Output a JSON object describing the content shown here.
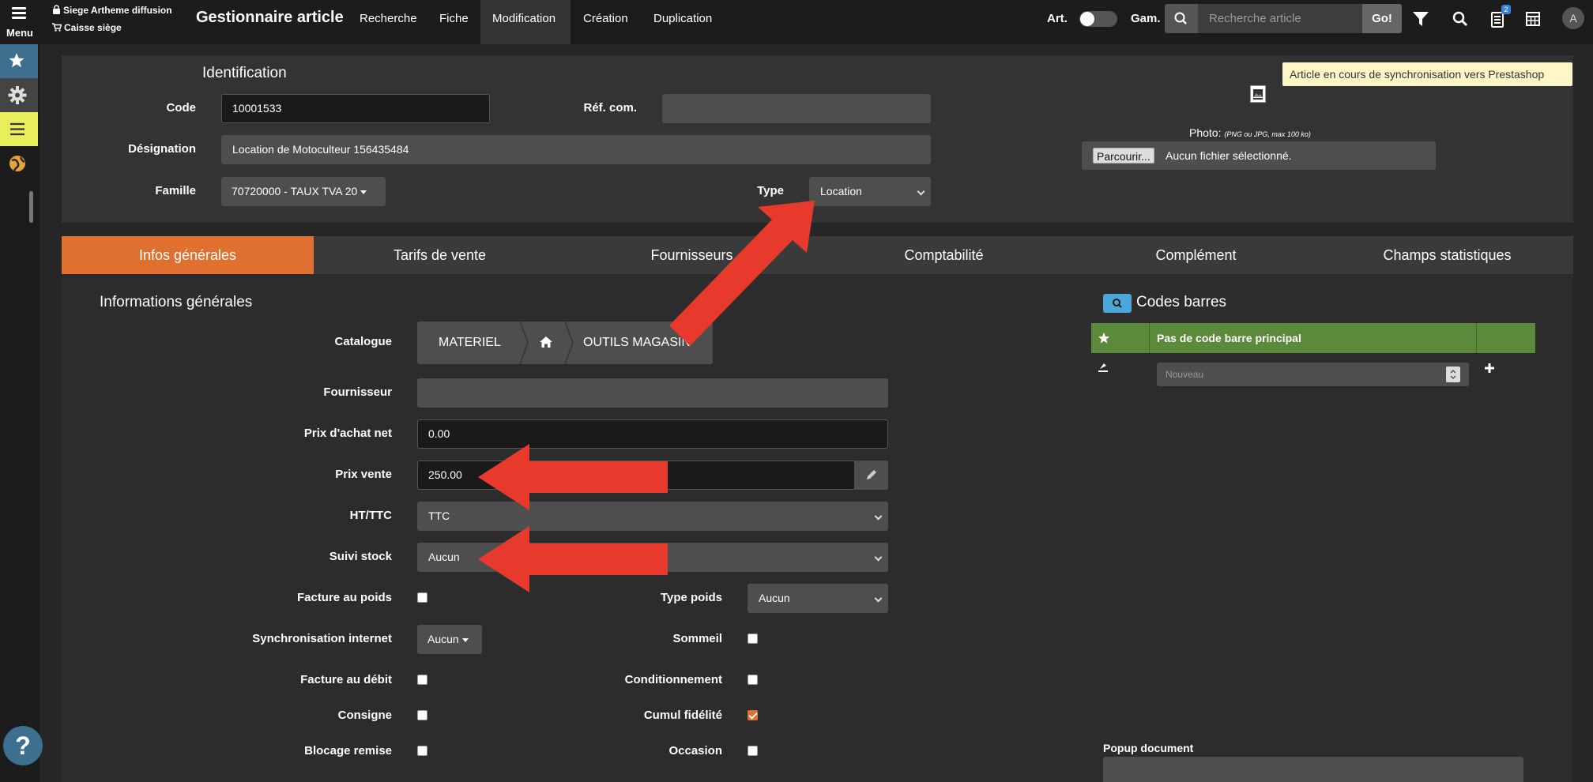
{
  "topbar": {
    "menu_label": "Menu",
    "site_name": "Siege Artheme diffusion",
    "register_name": "Caisse siège",
    "app_title": "Gestionnaire article",
    "nav": [
      "Recherche",
      "Fiche",
      "Modification",
      "Création",
      "Duplication"
    ],
    "active_nav": "Modification",
    "art_label": "Art.",
    "gam_label": "Gam.",
    "search_placeholder": "Recherche article",
    "go_label": "Go!",
    "notification_count": "2",
    "avatar_letter": "A"
  },
  "sidebar": {
    "items": [
      "star-icon",
      "gear-icon",
      "list-icon",
      "globe-icon"
    ],
    "colors": {
      "star_bg": "#3d6f8e",
      "list_bg": "#e8ef5a",
      "active_tab": "#e0702f",
      "barcode_header": "#5a8a3a"
    }
  },
  "identification": {
    "title": "Identification",
    "code_label": "Code",
    "code_value": "10001533",
    "ref_label": "Réf. com.",
    "ref_value": "",
    "designation_label": "Désignation",
    "designation_value": "Location de Motoculteur 156435484",
    "famille_label": "Famille",
    "famille_value": "70720000 - TAUX TVA 20",
    "type_label": "Type",
    "type_value": "Location",
    "photo_label": "Photo:",
    "photo_hint": "(PNG ou JPG, max 100 ko)",
    "browse_label": "Parcourir...",
    "no_file_label": "Aucun fichier sélectionné.",
    "sync_message": "Article en cours de synchronisation vers Prestashop"
  },
  "tabs": [
    "Infos générales",
    "Tarifs de vente",
    "Fournisseurs",
    "Comptabilité",
    "Complément",
    "Champs statistiques"
  ],
  "general": {
    "title": "Informations générales",
    "catalogue_label": "Catalogue",
    "catalogue_path": [
      "MATERIEL",
      "OUTILS MAGASIN"
    ],
    "fournisseur_label": "Fournisseur",
    "fournisseur_value": "",
    "prix_achat_label": "Prix d'achat net",
    "prix_achat_value": "0.00",
    "prix_vente_label": "Prix vente",
    "prix_vente_value": "250.00",
    "ht_ttc_label": "HT/TTC",
    "ht_ttc_value": "TTC",
    "suivi_stock_label": "Suivi stock",
    "suivi_stock_value": "Aucun",
    "facture_poids_label": "Facture au poids",
    "type_poids_label": "Type poids",
    "type_poids_value": "Aucun",
    "sync_internet_label": "Synchronisation internet",
    "sync_internet_value": "Aucun",
    "sommeil_label": "Sommeil",
    "facture_debit_label": "Facture au débit",
    "conditionnement_label": "Conditionnement",
    "consigne_label": "Consigne",
    "cumul_fidelite_label": "Cumul fidélité",
    "cumul_fidelite_checked": true,
    "blocage_remise_label": "Blocage remise",
    "occasion_label": "Occasion"
  },
  "barcodes": {
    "title": "Codes barres",
    "header_text": "Pas de code barre principal",
    "new_placeholder": "Nouveau",
    "popup_document_label": "Popup document"
  }
}
